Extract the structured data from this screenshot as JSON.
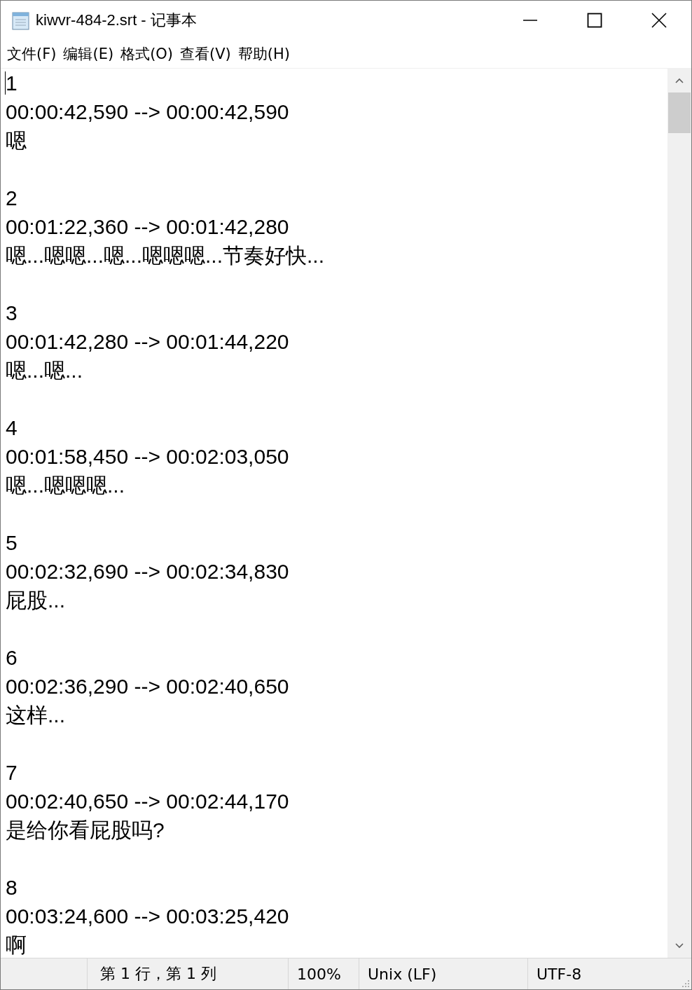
{
  "window": {
    "title": "kiwvr-484-2.srt - 记事本"
  },
  "menu": [
    "文件(F)",
    "编辑(E)",
    "格式(O)",
    "查看(V)",
    "帮助(H)"
  ],
  "entries": [
    {
      "index": "1",
      "time": "00:00:42,590 --> 00:00:42,590",
      "text": "嗯"
    },
    {
      "index": "2",
      "time": "00:01:22,360 --> 00:01:42,280",
      "text": "嗯...嗯嗯...嗯...嗯嗯嗯...节奏好快..."
    },
    {
      "index": "3",
      "time": "00:01:42,280 --> 00:01:44,220",
      "text": "嗯...嗯..."
    },
    {
      "index": "4",
      "time": "00:01:58,450 --> 00:02:03,050",
      "text": "嗯...嗯嗯嗯..."
    },
    {
      "index": "5",
      "time": "00:02:32,690 --> 00:02:34,830",
      "text": "屁股..."
    },
    {
      "index": "6",
      "time": "00:02:36,290 --> 00:02:40,650",
      "text": "这样..."
    },
    {
      "index": "7",
      "time": "00:02:40,650 --> 00:02:44,170",
      "text": "是给你看屁股吗?"
    },
    {
      "index": "8",
      "time": "00:03:24,600 --> 00:03:25,420",
      "text": "啊"
    }
  ],
  "status_bar": {
    "position": "第 1 行，第 1 列",
    "zoom": "100%",
    "line_ending": "Unix (LF)",
    "encoding": "UTF-8"
  }
}
